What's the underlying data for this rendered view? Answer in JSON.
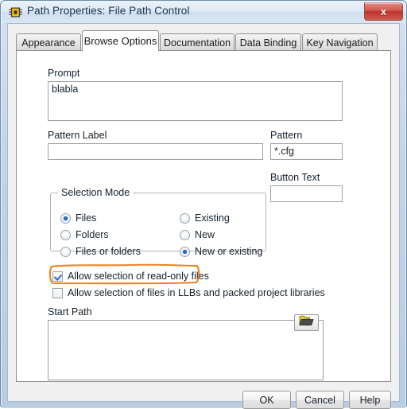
{
  "window": {
    "title": "Path Properties: File Path Control",
    "icon": "labview-vi-icon",
    "close_label": "x"
  },
  "tabs": [
    {
      "label": "Appearance",
      "active": false
    },
    {
      "label": "Browse Options",
      "active": true
    },
    {
      "label": "Documentation",
      "active": false
    },
    {
      "label": "Data Binding",
      "active": false
    },
    {
      "label": "Key Navigation",
      "active": false
    }
  ],
  "browse_options": {
    "prompt": {
      "label": "Prompt",
      "value": "blabla"
    },
    "pattern_label": {
      "label": "Pattern Label",
      "value": ""
    },
    "pattern": {
      "label": "Pattern",
      "value": "*.cfg"
    },
    "button_text": {
      "label": "Button Text",
      "value": ""
    },
    "selection_mode": {
      "title": "Selection Mode",
      "left_options": [
        {
          "label": "Files",
          "selected": true
        },
        {
          "label": "Folders",
          "selected": false
        },
        {
          "label": "Files or folders",
          "selected": false
        }
      ],
      "right_options": [
        {
          "label": "Existing",
          "selected": false
        },
        {
          "label": "New",
          "selected": false
        },
        {
          "label": "New or existing",
          "selected": true
        }
      ]
    },
    "checkboxes": [
      {
        "label": "Allow selection of read-only files",
        "checked": true,
        "highlighted": true
      },
      {
        "label": "Allow selection of files in LLBs and packed project libraries",
        "checked": false,
        "highlighted": false
      }
    ],
    "start_path": {
      "label": "Start Path",
      "value": ""
    },
    "browse_button": {
      "icon": "open-folder-icon"
    }
  },
  "footer": {
    "ok": "OK",
    "cancel": "Cancel",
    "help": "Help"
  },
  "colors": {
    "annotation": "#ed8322",
    "accent_blue": "#1a6fc4",
    "title_text": "#17334f",
    "close_red": "#c4413a"
  }
}
